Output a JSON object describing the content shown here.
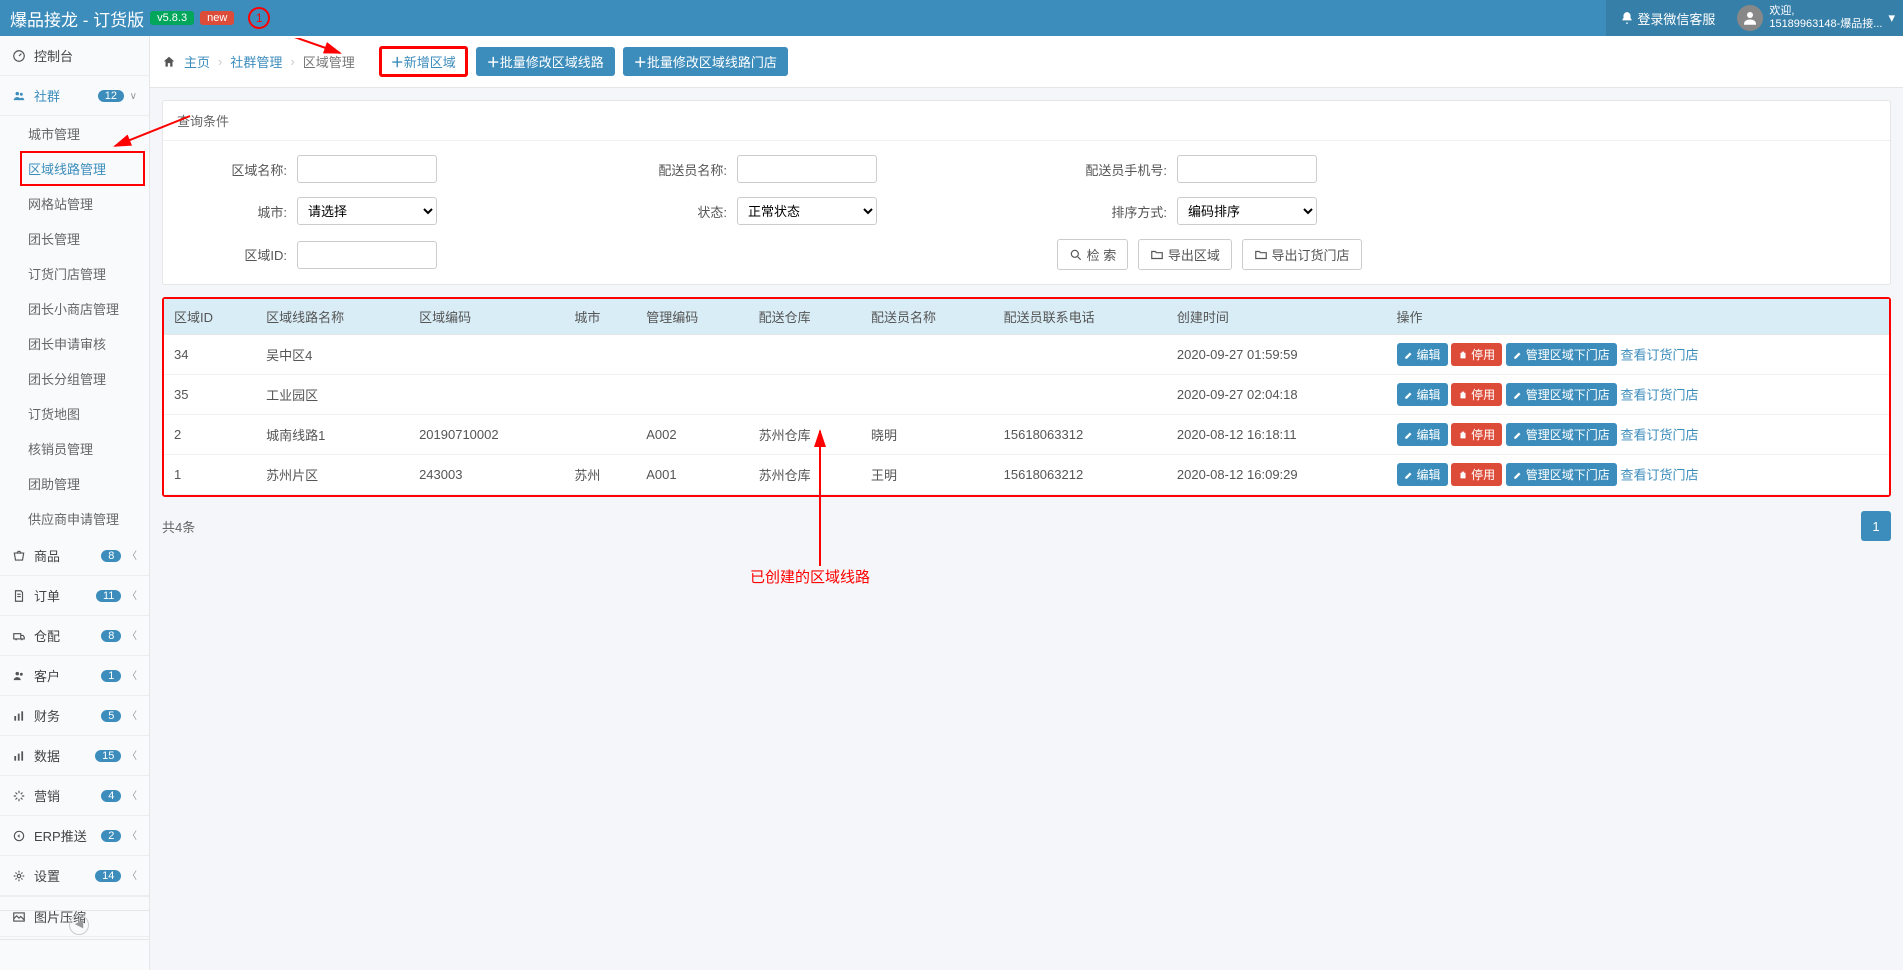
{
  "header": {
    "title": "爆品接龙 - 订货版",
    "version": "v5.8.3",
    "new_tag": "new",
    "annotation_num": "1",
    "login_cs": "登录微信客服",
    "welcome": "欢迎,",
    "user_info": "15189963148-爆品接..."
  },
  "sidebar": {
    "top": {
      "label": "控制台"
    },
    "community": {
      "label": "社群",
      "badge": "12"
    },
    "subs": [
      "城市管理",
      "区域线路管理",
      "网格站管理",
      "团长管理",
      "订货门店管理",
      "团长小商店管理",
      "团长申请审核",
      "团长分组管理",
      "订货地图",
      "核销员管理",
      "团助管理",
      "供应商申请管理"
    ],
    "groups": [
      {
        "label": "商品",
        "badge": "8"
      },
      {
        "label": "订单",
        "badge": "11"
      },
      {
        "label": "仓配",
        "badge": "8"
      },
      {
        "label": "客户",
        "badge": "1"
      },
      {
        "label": "财务",
        "badge": "5"
      },
      {
        "label": "数据",
        "badge": "15"
      },
      {
        "label": "营销",
        "badge": "4"
      },
      {
        "label": "ERP推送",
        "badge": "2"
      },
      {
        "label": "设置",
        "badge": "14"
      }
    ],
    "bottom": "图片压缩"
  },
  "crumb": {
    "home": "主页",
    "lvl1": "社群管理",
    "lvl2": "区域管理",
    "btn_add": "新增区域",
    "btn_batch_route": "批量修改区域线路",
    "btn_batch_store": "批量修改区域线路门店"
  },
  "filter": {
    "panel_title": "查询条件",
    "lbl_area_name": "区域名称:",
    "lbl_courier_name": "配送员名称:",
    "lbl_courier_phone": "配送员手机号:",
    "lbl_city": "城市:",
    "city_placeholder": "请选择",
    "lbl_status": "状态:",
    "status_value": "正常状态",
    "lbl_sort": "排序方式:",
    "sort_value": "编码排序",
    "lbl_area_id": "区域ID:",
    "btn_search": "检 索",
    "btn_export_area": "导出区域",
    "btn_export_store": "导出订货门店"
  },
  "table": {
    "headers": [
      "区域ID",
      "区域线路名称",
      "区域编码",
      "城市",
      "管理编码",
      "配送仓库",
      "配送员名称",
      "配送员联系电话",
      "创建时间",
      "操作"
    ],
    "rows": [
      {
        "c": [
          "34",
          "吴中区4",
          "",
          "",
          "",
          "",
          "",
          "",
          "2020-09-27 01:59:59"
        ]
      },
      {
        "c": [
          "35",
          "工业园区",
          "",
          "",
          "",
          "",
          "",
          "",
          "2020-09-27 02:04:18"
        ]
      },
      {
        "c": [
          "2",
          "城南线路1",
          "20190710002",
          "",
          "A002",
          "苏州仓库",
          "晓明",
          "15618063312",
          "2020-08-12 16:18:11"
        ]
      },
      {
        "c": [
          "1",
          "苏州片区",
          "243003",
          "苏州",
          "A001",
          "苏州仓库",
          "王明",
          "15618063212",
          "2020-08-12 16:09:29"
        ]
      }
    ],
    "act_edit": "编辑",
    "act_stop": "停用",
    "act_manage": "管理区域下门店",
    "act_view": "查看订货门店"
  },
  "footer": {
    "total": "共4条",
    "page": "1"
  },
  "annotation": {
    "text": "已创建的区域线路"
  }
}
